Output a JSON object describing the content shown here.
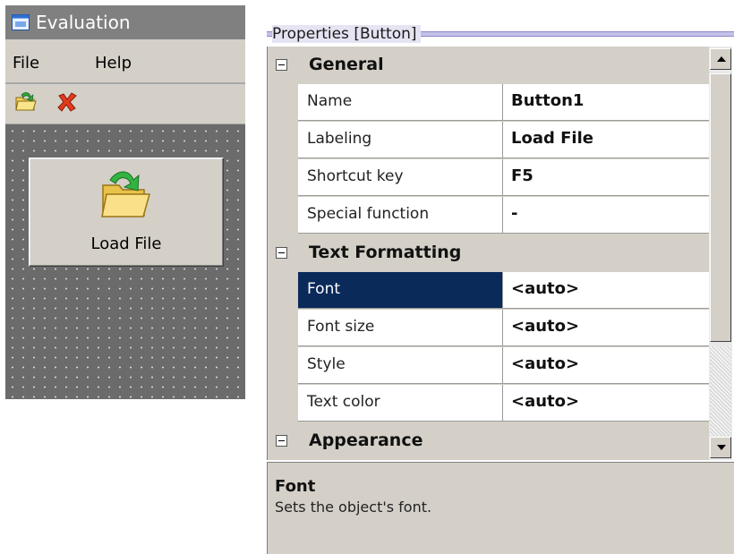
{
  "window": {
    "title": "Evaluation",
    "icon": "window-app-icon",
    "menu": [
      {
        "label": "File"
      },
      {
        "label": "Help"
      }
    ],
    "toolbar": [
      {
        "icon": "open-folder-icon"
      },
      {
        "icon": "close-x-icon"
      }
    ],
    "button": {
      "label": "Load File",
      "icon": "open-folder-icon"
    }
  },
  "properties": {
    "header": "Properties [Button]",
    "categories": [
      {
        "title": "General",
        "rows": [
          {
            "name": "Name",
            "value": "Button1"
          },
          {
            "name": "Labeling",
            "value": "Load File"
          },
          {
            "name": "Shortcut key",
            "value": "F5"
          },
          {
            "name": "Special function",
            "value": "-"
          }
        ]
      },
      {
        "title": "Text Formatting",
        "rows": [
          {
            "name": "Font",
            "value": "<auto>",
            "selected": true
          },
          {
            "name": "Font size",
            "value": "<auto>"
          },
          {
            "name": "Style",
            "value": "<auto>"
          },
          {
            "name": "Text color",
            "value": "<auto>"
          }
        ]
      },
      {
        "title": "Appearance",
        "rows": []
      }
    ],
    "description": {
      "title": "Font",
      "text": "Sets the object's font."
    }
  },
  "colors": {
    "selection": "#0a2a5a",
    "canvas": "#6b6b6b",
    "chrome": "#d4d0c8"
  }
}
